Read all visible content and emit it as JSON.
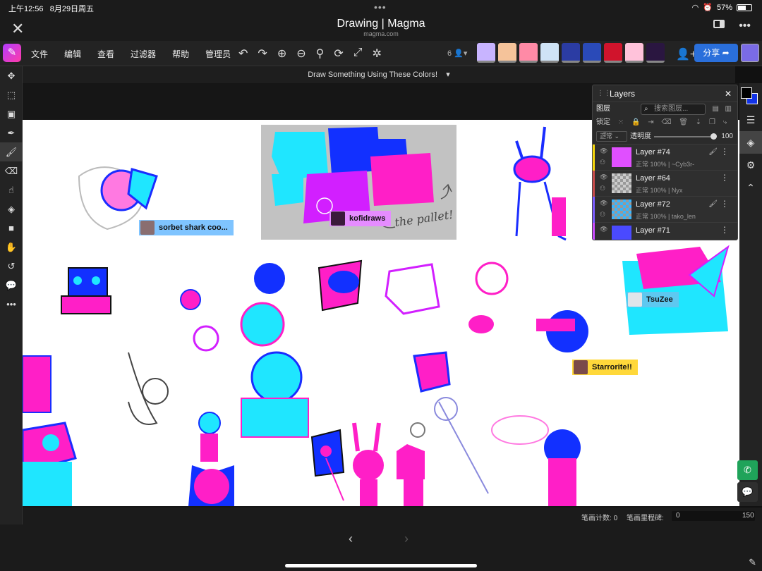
{
  "status": {
    "time": "上午12:56",
    "date": "8月29日周五",
    "battery": "57%",
    "more": "•••"
  },
  "window": {
    "title": "Drawing | Magma",
    "subtitle": "magma.com"
  },
  "menu": [
    "文件",
    "编辑",
    "查看",
    "过滤器",
    "帮助",
    "管理员"
  ],
  "toolbar_icons": [
    "undo-icon",
    "redo-icon",
    "zoom-in-icon",
    "zoom-out-icon",
    "fit-icon",
    "rotate-icon",
    "fullscreen-icon",
    "settings-icon"
  ],
  "collab": {
    "user_count": "6",
    "share_label": "分享",
    "avatar_colors": [
      "#c8b4ff",
      "#f5c39a",
      "#ff8aa6",
      "#cfe3f6",
      "#2b3ca3",
      "#2a4ab8",
      "#d0142c",
      "#ffc2da",
      "#2a1640"
    ]
  },
  "document": {
    "title": "Draw Something Using These Colors!"
  },
  "left_tools": [
    "select-move-icon",
    "marquee-icon",
    "transform-icon",
    "eyedropper-icon",
    "brush-icon",
    "eraser-icon",
    "smudge-icon",
    "fill-icon",
    "shape-icon",
    "hand-icon",
    "undo-history-icon",
    "comment-icon",
    "more-icon"
  ],
  "layers_panel": {
    "title": "Layers",
    "section": "图层",
    "search_placeholder": "搜索图层...",
    "lock_label": "锁定",
    "blend_mode": "正常",
    "opacity_label": "透明度",
    "opacity_value": "100",
    "layers": [
      {
        "name": "Layer #74",
        "meta": "正常 100% | ~Cyb3r-",
        "color": "#f5d60b",
        "thumb": "#e04fff"
      },
      {
        "name": "Layer #64",
        "meta": "正常 100% | Nyx",
        "color": "#c94b4b",
        "thumb": ""
      },
      {
        "name": "Layer #72",
        "meta": "正常 100% | tako_len",
        "color": "#7b5cff",
        "thumb": "#38b6ff"
      },
      {
        "name": "Layer #71",
        "meta": "",
        "color": "#c94bff",
        "thumb": "#4a4aff"
      }
    ]
  },
  "name_tags": [
    {
      "label": "sorbet shark coo...",
      "bg": "#7fc4ff"
    },
    {
      "label": "kofidraws",
      "bg": "#e58cff"
    },
    {
      "label": "TsuZee",
      "bg": "#5ec8f0"
    },
    {
      "label": "Starrorite!!",
      "bg": "#ffd83a"
    }
  ],
  "canvas_annotation": "the pallet!",
  "stats": {
    "stroke_count_label": "笔画计数:",
    "stroke_count": "0",
    "stroke_dist_label": "笔画里程碑:",
    "range_start": "0",
    "range_end": "150"
  },
  "palette": {
    "cyan": "#1fe6ff",
    "blue": "#1230ff",
    "magenta": "#ff1fc7",
    "purple": "#d21fff"
  }
}
